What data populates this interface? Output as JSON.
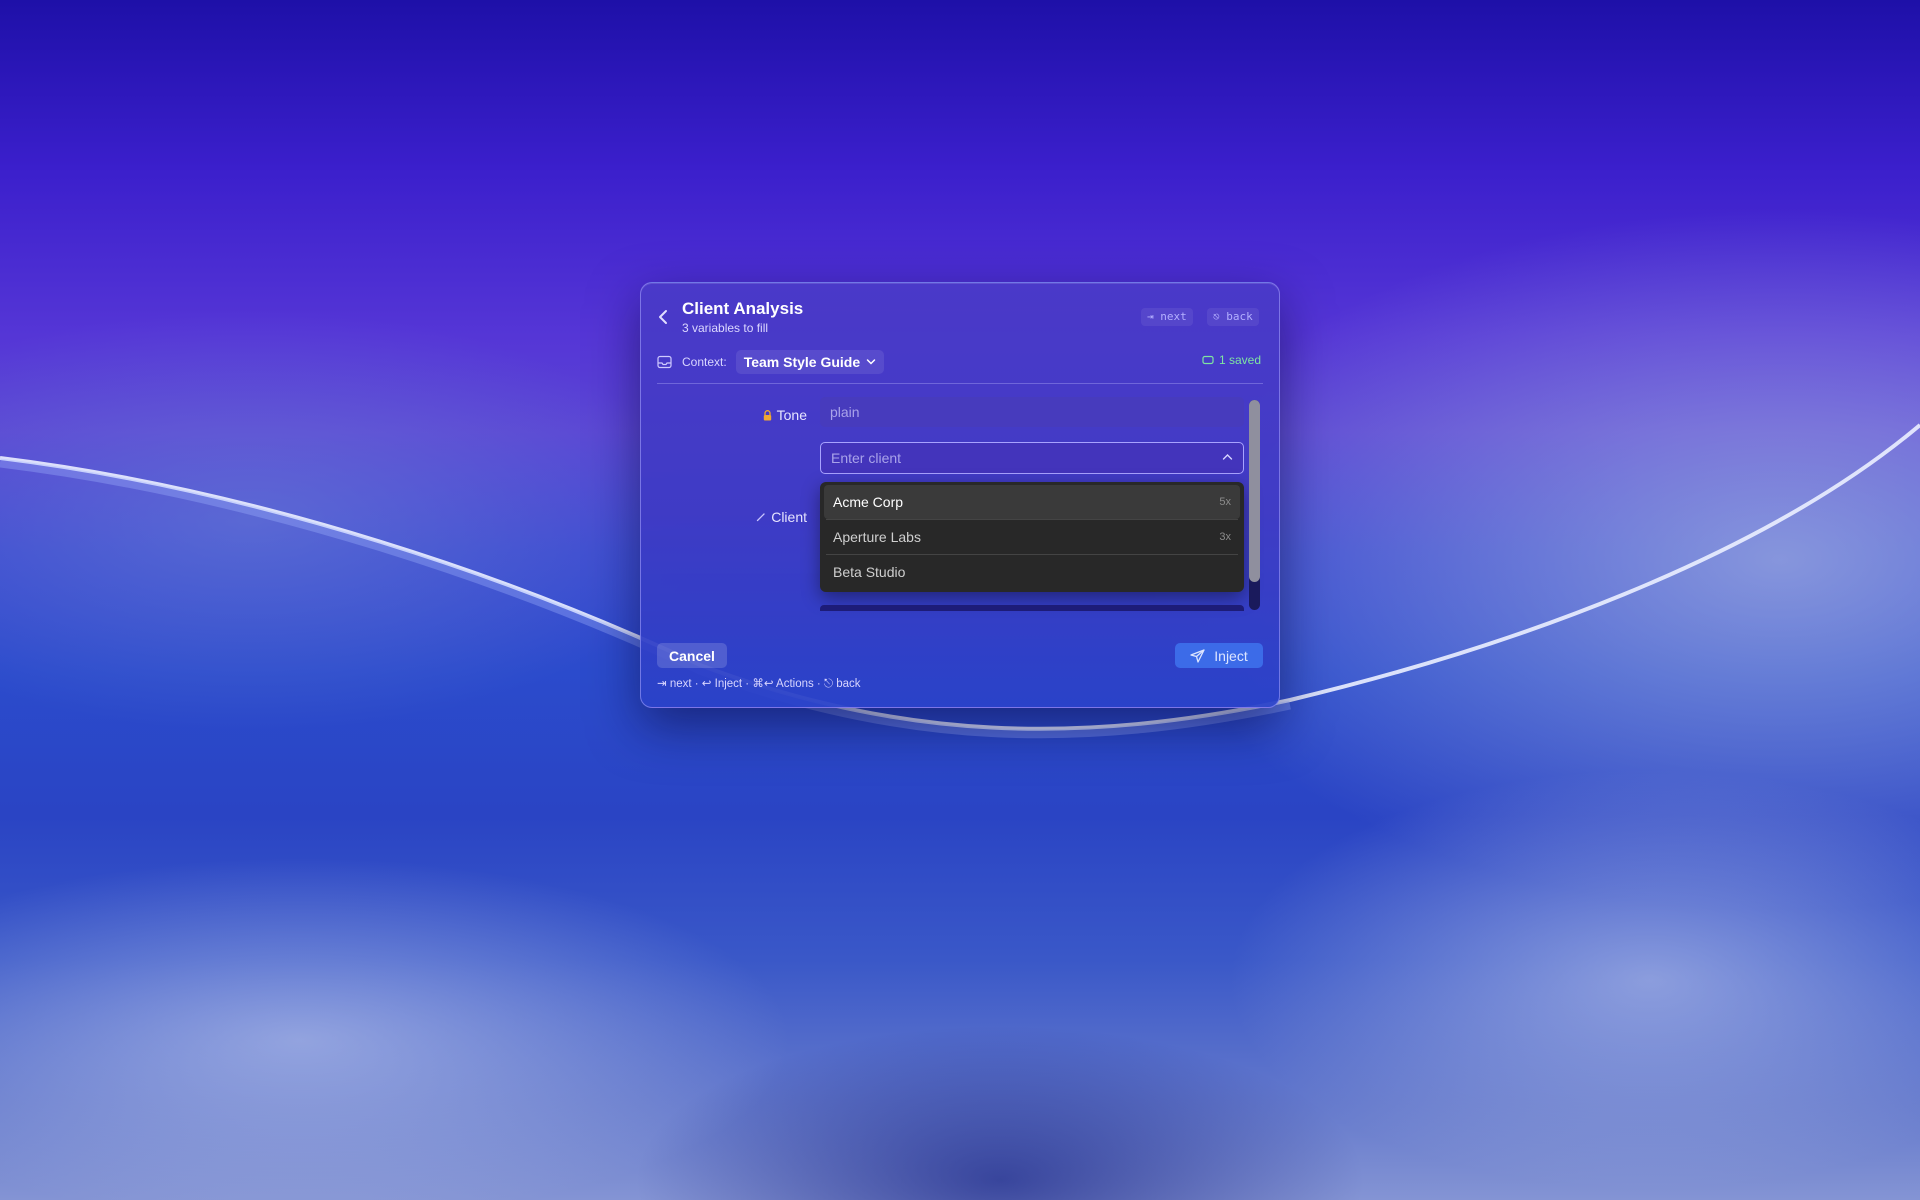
{
  "dialog": {
    "title": "Client Analysis",
    "subtitle": "3 variables to fill",
    "shortcut_next": "⇥ next",
    "shortcut_back": "⎋ back"
  },
  "context": {
    "label": "Context:",
    "selected": "Team Style Guide",
    "saved_status": "1 saved"
  },
  "fields": {
    "tone": {
      "label": "Tone",
      "placeholder": "plain",
      "locked": true
    },
    "client": {
      "label": "Client",
      "placeholder": "Enter client"
    }
  },
  "dropdown": {
    "items": [
      {
        "label": "Acme Corp",
        "count": "5x"
      },
      {
        "label": "Aperture Labs",
        "count": "3x"
      },
      {
        "label": "Beta Studio",
        "count": ""
      }
    ]
  },
  "footer": {
    "cancel_label": "Cancel",
    "inject_label": "Inject",
    "hint": "⇥ next · ↩ Inject · ⌘↩ Actions · ⎋ back"
  },
  "icons": {
    "back": "chevron-left-icon",
    "context": "inbox-icon",
    "saved": "badge-icon",
    "lock": "lock-icon",
    "edit": "pencil-icon",
    "dropdown_toggle": "chevron-up-icon",
    "inject": "send-icon"
  },
  "colors": {
    "accent": "#3c6be8",
    "saved": "#7fe4a2",
    "lock": "#f0a830",
    "dropdown_bg": "#282828"
  }
}
